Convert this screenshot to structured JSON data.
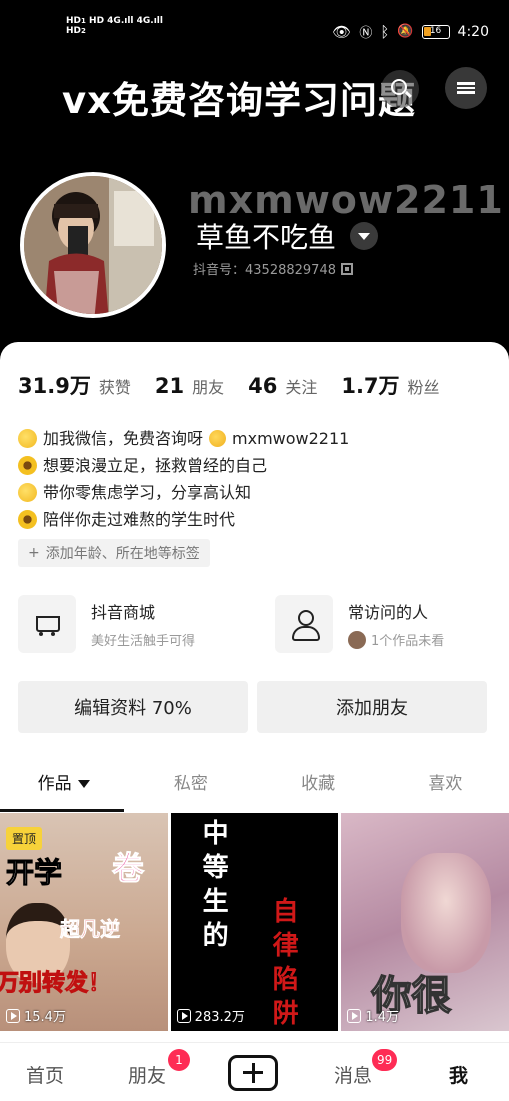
{
  "status_bar": {
    "network_left": "HD 4G",
    "network_right": "HD 4G",
    "battery": "16",
    "time": "4:20"
  },
  "header": {
    "promo_text": "vx免费咨询学习问题",
    "username_overlay": "mxmwow2211",
    "nickname": "草鱼不吃鱼",
    "douyin_id": "抖音号：43528829748"
  },
  "stats": [
    {
      "num": "31.9万",
      "label": "获赞"
    },
    {
      "num": "21",
      "label": "朋友"
    },
    {
      "num": "46",
      "label": "关注"
    },
    {
      "num": "1.7万",
      "label": "粉丝"
    }
  ],
  "bio": [
    {
      "emoji": "moon",
      "text": "加我微信，免费咨询呀",
      "emoji2": "hug",
      "tail": "mxmwow2211"
    },
    {
      "emoji": "flower",
      "text": "想要浪漫立足，拯救曾经的自己"
    },
    {
      "emoji": "moon",
      "text": "带你零焦虑学习，分享高认知"
    },
    {
      "emoji": "flower",
      "text": "陪伴你走过难熬的学生时代"
    }
  ],
  "tag_button": "添加年龄、所在地等标签",
  "features": {
    "shop_title": "抖音商城",
    "shop_sub": "美好生活触手可得",
    "visitors_title": "常访问的人",
    "visitors_sub": "1个作品未看"
  },
  "actions": {
    "edit_profile": "编辑资料 70%",
    "add_friend": "添加朋友"
  },
  "tabs": [
    "作品",
    "私密",
    "收藏",
    "喜欢"
  ],
  "videos": [
    {
      "pin": "置顶",
      "title_a": "开学",
      "title_b": "卷",
      "subtitle": "超凡逆",
      "bottom": "万别转发！",
      "plays": "15.4万"
    },
    {
      "title_a": "中等生的",
      "title_b": "自律陷阱",
      "plays": "283.2万"
    },
    {
      "title_a": "你很",
      "plays": "1.4万"
    }
  ],
  "bottom_nav": {
    "home": "首页",
    "friends": "朋友",
    "friends_badge": "1",
    "messages": "消息",
    "messages_badge": "99",
    "me": "我"
  },
  "colors": {
    "accent_badge": "#fe2c55",
    "pin_yellow": "#f7d23a"
  }
}
